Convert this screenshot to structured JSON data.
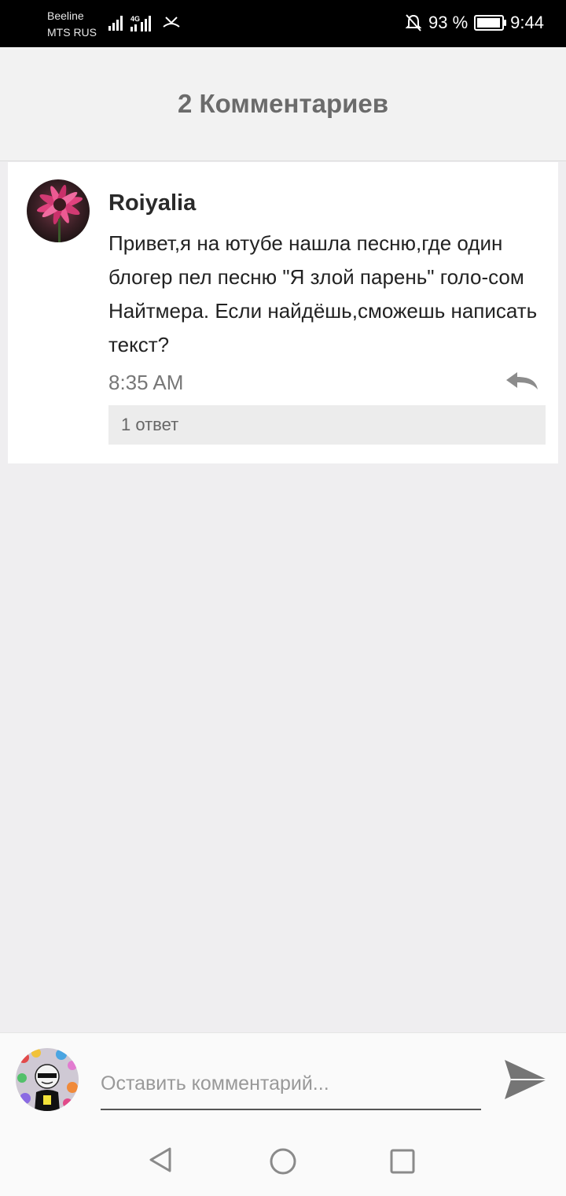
{
  "status_bar": {
    "carrier_1": "Beeline",
    "carrier_2": "MTS RUS",
    "network_badge": "4G",
    "battery": "93 %",
    "time": "9:44"
  },
  "header": {
    "title": "2 Комментариев"
  },
  "comment": {
    "author": "Roiyalia",
    "text": "Привет,я на ютубе нашла песню,где один блогер пел песню \"Я злой парень\" голо-сом Найтмера. Если найдёшь,сможешь написать текст?",
    "time": "8:35 AM",
    "replies_label": "1 ответ"
  },
  "compose": {
    "placeholder": "Оставить комментарий..."
  },
  "icons": {
    "reply": "reply-icon",
    "send": "send-icon",
    "back": "back-icon",
    "home": "home-icon",
    "recent": "recent-apps-icon"
  },
  "colors": {
    "background": "#efeef0",
    "header_text": "#6b6b6b",
    "icon_gray": "#7a7a7a"
  }
}
